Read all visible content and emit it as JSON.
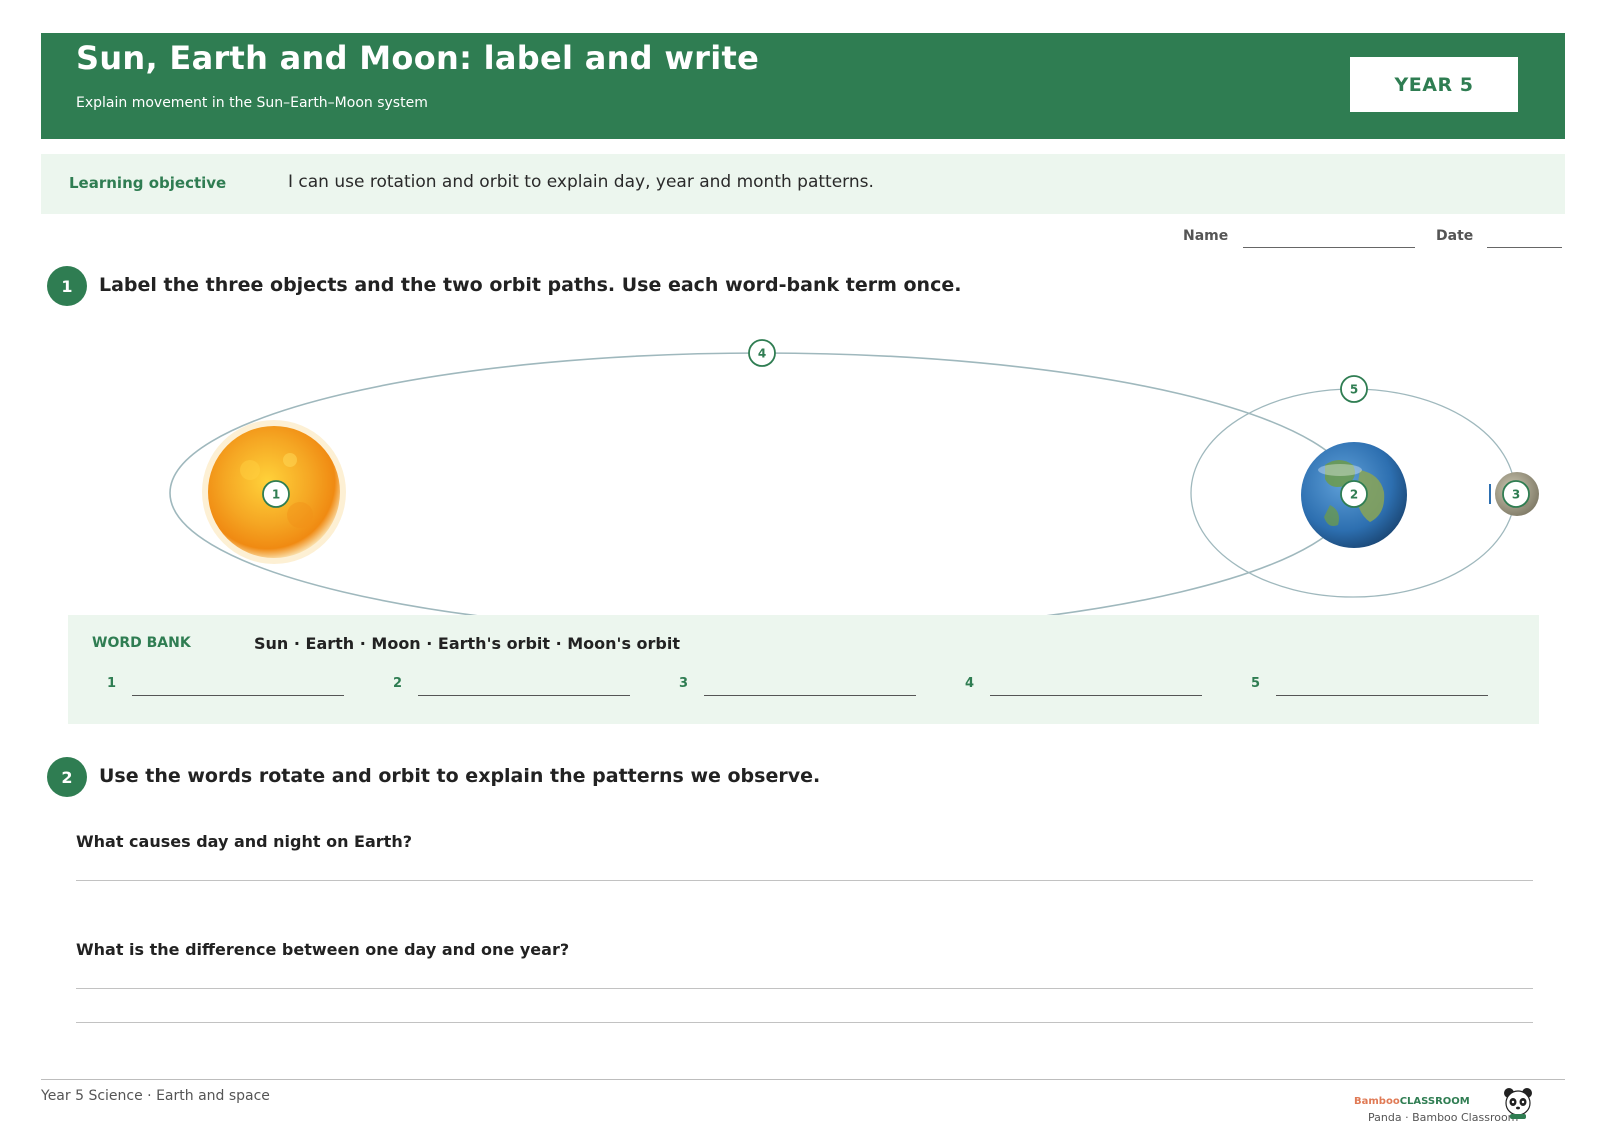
{
  "header": {
    "title": "Sun, Earth and Moon: label and write",
    "subtitle": "Explain movement in the Sun–Earth–Moon system",
    "year_badge": "YEAR 5"
  },
  "objective": {
    "label": "Learning objective",
    "text": "I can use rotation and orbit to explain day, year and month patterns."
  },
  "fields": {
    "name_label": "Name",
    "date_label": "Date"
  },
  "question1": {
    "number": "1",
    "text": "Label the three objects and the two orbit paths. Use each word-bank term once."
  },
  "diagram": {
    "markers": [
      "1",
      "2",
      "3",
      "4",
      "5"
    ],
    "colors": {
      "sun": "#f5a623",
      "earth": "#2d6fb0",
      "moon": "#a8a390",
      "orbit": "#9fb8bd",
      "marker": "#2f7d52"
    }
  },
  "word_bank": {
    "label": "WORD BANK",
    "words": "Sun · Earth · Moon · Earth's orbit · Moon's orbit",
    "blanks": [
      "1",
      "2",
      "3",
      "4",
      "5"
    ]
  },
  "question2": {
    "number": "2",
    "text": "Use the words rotate and orbit to explain the patterns we observe.",
    "prompt1": "What causes day and night on Earth?",
    "prompt2": "What is the difference between one day and one year?"
  },
  "footer": {
    "left": "Year 5 Science · Earth and space",
    "brand_part1": "Bamboo",
    "brand_part2": "CLASSROOM",
    "brand_sub": "Panda · Bamboo Classroom"
  },
  "colors": {
    "primary": "#2f7d52",
    "panel": "#ecf6ee"
  }
}
